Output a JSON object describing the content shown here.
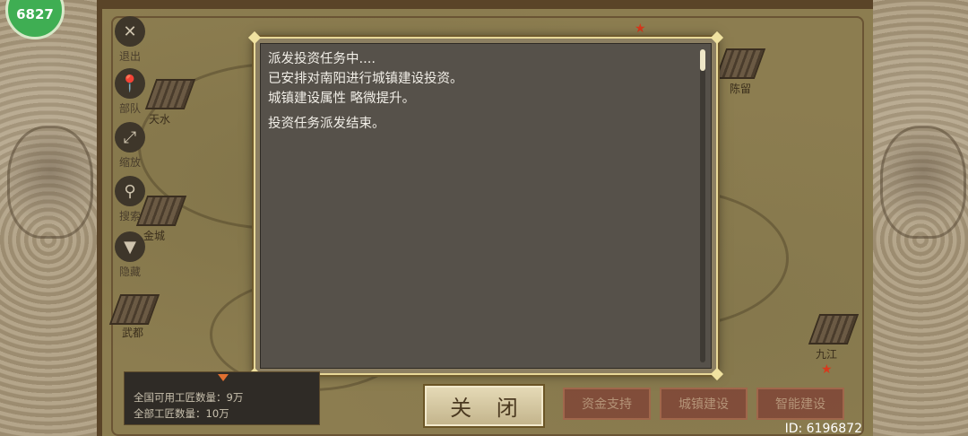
{
  "badge": {
    "value": "6827"
  },
  "map": {
    "cities": [
      {
        "name": "天水"
      },
      {
        "name": "金城"
      },
      {
        "name": "武都"
      },
      {
        "name": "陈留"
      },
      {
        "name": "九江"
      }
    ]
  },
  "tools": [
    {
      "label": "退出",
      "icon": "close-icon",
      "glyph": "✕"
    },
    {
      "label": "部队",
      "icon": "location-pin-icon",
      "glyph": "⬤"
    },
    {
      "label": "缩放",
      "icon": "zoom-expand-icon",
      "glyph": "⤢"
    },
    {
      "label": "搜索",
      "icon": "search-icon",
      "glyph": "⚲"
    },
    {
      "label": "隐藏",
      "icon": "chevron-down-icon",
      "glyph": "▼"
    }
  ],
  "dialog": {
    "lines": [
      "派发投资任务中....",
      "已安排对南阳进行城镇建设投资。",
      "城镇建设属性 略微提升。",
      "投资任务派发结束。"
    ]
  },
  "info": {
    "available_workers": "全国可用工匠数量：9万",
    "total_workers": "全部工匠数量：10万"
  },
  "buttons": {
    "close": "关 闭",
    "fund_support": "资金支持",
    "town_build": "城镇建设",
    "smart_build": "智能建设"
  },
  "player_id": "ID: 6196872",
  "colors": {
    "dialog_bg": "#56514a",
    "dialog_border": "#e8d898",
    "action_button": "#7c2a2a",
    "badge_green": "#3fae53"
  }
}
